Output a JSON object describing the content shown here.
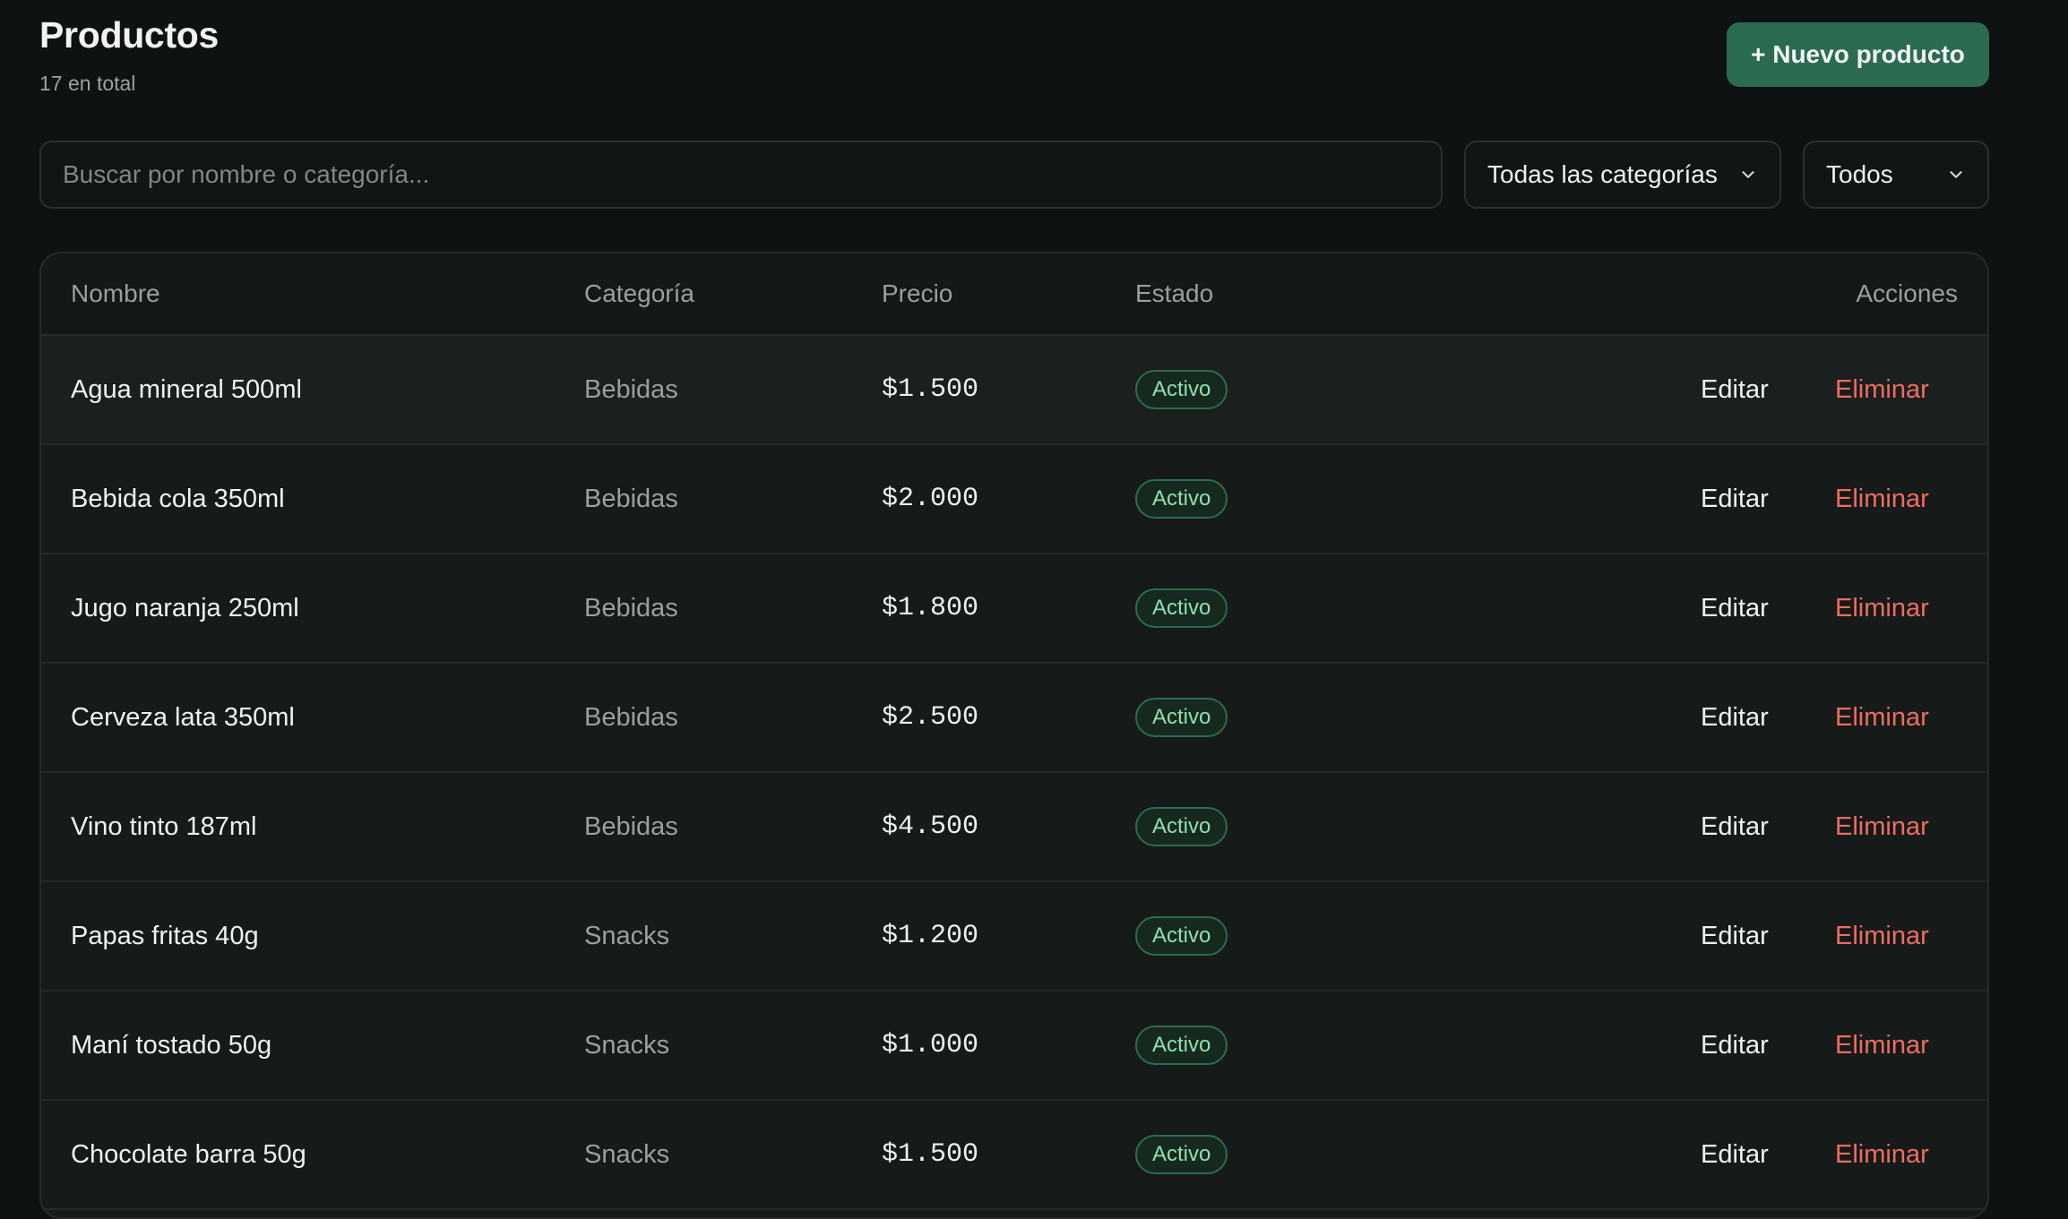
{
  "header": {
    "title": "Productos",
    "count_text": "17 en total",
    "new_button_label": "+ Nuevo producto"
  },
  "filters": {
    "search_placeholder": "Buscar por nombre o categoría...",
    "search_value": "",
    "category_select": "Todas las categorías",
    "status_select": "Todos"
  },
  "table": {
    "columns": {
      "name": "Nombre",
      "category": "Categoría",
      "price": "Precio",
      "status": "Estado",
      "actions": "Acciones"
    },
    "rows": [
      {
        "name": "Agua mineral 500ml",
        "category": "Bebidas",
        "price": "$1.500",
        "status": "Activo",
        "edit": "Editar",
        "delete": "Eliminar"
      },
      {
        "name": "Bebida cola 350ml",
        "category": "Bebidas",
        "price": "$2.000",
        "status": "Activo",
        "edit": "Editar",
        "delete": "Eliminar"
      },
      {
        "name": "Jugo naranja 250ml",
        "category": "Bebidas",
        "price": "$1.800",
        "status": "Activo",
        "edit": "Editar",
        "delete": "Eliminar"
      },
      {
        "name": "Cerveza lata 350ml",
        "category": "Bebidas",
        "price": "$2.500",
        "status": "Activo",
        "edit": "Editar",
        "delete": "Eliminar"
      },
      {
        "name": "Vino tinto 187ml",
        "category": "Bebidas",
        "price": "$4.500",
        "status": "Activo",
        "edit": "Editar",
        "delete": "Eliminar"
      },
      {
        "name": "Papas fritas 40g",
        "category": "Snacks",
        "price": "$1.200",
        "status": "Activo",
        "edit": "Editar",
        "delete": "Eliminar"
      },
      {
        "name": "Maní tostado 50g",
        "category": "Snacks",
        "price": "$1.000",
        "status": "Activo",
        "edit": "Editar",
        "delete": "Eliminar"
      },
      {
        "name": "Chocolate barra 50g",
        "category": "Snacks",
        "price": "$1.500",
        "status": "Activo",
        "edit": "Editar",
        "delete": "Eliminar"
      }
    ]
  },
  "colors": {
    "background": "#0f1212",
    "accent": "#2b6b52",
    "active_badge": "#8fe0b0",
    "delete": "#ea6e63"
  },
  "icons": {
    "select_arrow": "chevron-down-icon"
  }
}
